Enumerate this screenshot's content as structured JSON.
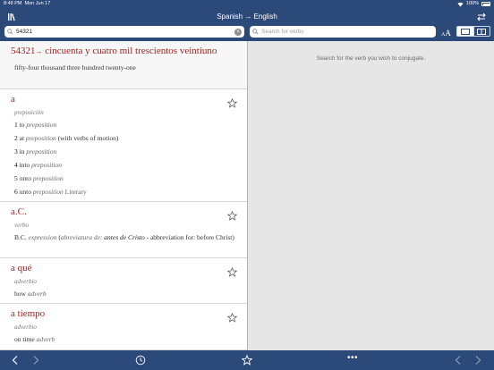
{
  "status": {
    "time": "8:48 PM",
    "date": "Mon Jun 17",
    "battery": "100%"
  },
  "nav": {
    "title": "Spanish → English"
  },
  "search": {
    "query": "54321",
    "verb_placeholder": "Search for verbs",
    "font_size_label_small": "A",
    "font_size_label_large": "A"
  },
  "detail": {
    "hint": "Search for the verb you wish to conjugate."
  },
  "entries": [
    {
      "headword": "54321",
      "arrow": "→",
      "expansion": "cincuenta y cuatro mil trescientos veintiuno",
      "translation": "fifty-four thousand three hundred twenty-one"
    },
    {
      "headword": "a",
      "pos": "preposición",
      "senses": [
        {
          "num": "1",
          "text": "to",
          "pos": "preposition",
          "extra": ""
        },
        {
          "num": "2",
          "text": "at",
          "pos": "preposition",
          "extra": "(with verbs of motion)"
        },
        {
          "num": "3",
          "text": "in",
          "pos": "preposition",
          "extra": ""
        },
        {
          "num": "4",
          "text": "into",
          "pos": "preposition",
          "extra": ""
        },
        {
          "num": "5",
          "text": "onto",
          "pos": "preposition",
          "extra": ""
        },
        {
          "num": "6",
          "text": "unto",
          "pos": "preposition",
          "extra": "Literary"
        }
      ]
    },
    {
      "headword": "a.C.",
      "pos": "verbo",
      "sense": {
        "text": "B.C.",
        "pos": "expression",
        "abbr_prefix": "(",
        "abbr_label": "abreviatura de:",
        "abbr_value": "antes de Cristo",
        "rest": " - abbreviation for: before Christ)"
      }
    },
    {
      "headword": "a qué",
      "pos": "adverbio",
      "sense": {
        "text": "how",
        "pos": "adverb"
      }
    },
    {
      "headword": "a tiempo",
      "pos": "adverbio",
      "sense": {
        "text": "on time",
        "pos": "adverb"
      }
    }
  ],
  "toolbar": {
    "more": "•••"
  },
  "colors": {
    "bar": "#2b4a7a",
    "headword": "#9b2420",
    "detail_bg": "#e6e6e6"
  }
}
